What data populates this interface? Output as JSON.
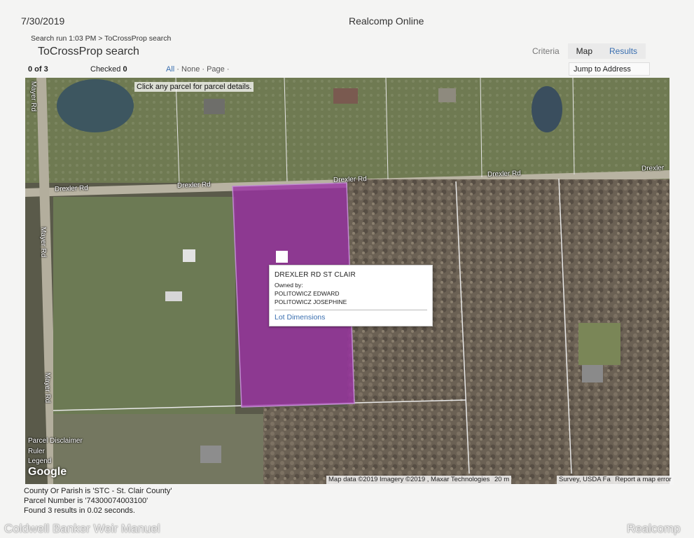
{
  "header": {
    "date": "7/30/2019",
    "app_title": "Realcomp Online",
    "breadcrumb": "Search run 1:03 PM > ToCrossProp search",
    "page_title": "ToCrossProp search"
  },
  "view_tabs": [
    "Criteria",
    "Map",
    "Results"
  ],
  "toolbar": {
    "count": "0 of 3",
    "checked_label": "Checked",
    "checked_value": "0",
    "select_all": "All",
    "select_none": "None",
    "select_page": "Page",
    "jump_to_address": "Jump to Address"
  },
  "map": {
    "hint": "Click any parcel for parcel details.",
    "roads": {
      "drexler_1": "Drexler Rd",
      "drexler_2": "Drexler Rd",
      "drexler_3": "Drexler Rd",
      "drexler_4": "Drexler Rd",
      "drexler_5": "Drexler",
      "mayer_1": "Mayer Rd",
      "mayer_2": "Mayer Rd",
      "mayer_3": "Mayer Rd"
    },
    "popup": {
      "title": "DREXLER RD ST CLAIR",
      "owned_by": "Owned by:",
      "owner1": "POLITOWICZ EDWARD",
      "owner2": "POLITOWICZ JOSEPHINE",
      "lot_dimensions": "Lot Dimensions"
    },
    "controls": {
      "disclaimer": "Parcel Disclaimer",
      "ruler": "Ruler",
      "legend": "Legend"
    },
    "google_logo": "Google",
    "attribution": "Map data ©2019 Imagery ©2019 , Maxar Technologies",
    "scale": "20 m",
    "attribution2": "Survey, USDA Fa",
    "report": "Report a map error",
    "parcel_color": "#9b2fa5"
  },
  "footer": {
    "county": "County Or Parish is 'STC - St. Clair County'",
    "parcel": "Parcel Number is '74300074003100'",
    "found": "Found 3 results in 0.02 seconds."
  },
  "watermarks": {
    "left": "Coldwell Banker Weir Manuel",
    "right": "Realcomp"
  }
}
